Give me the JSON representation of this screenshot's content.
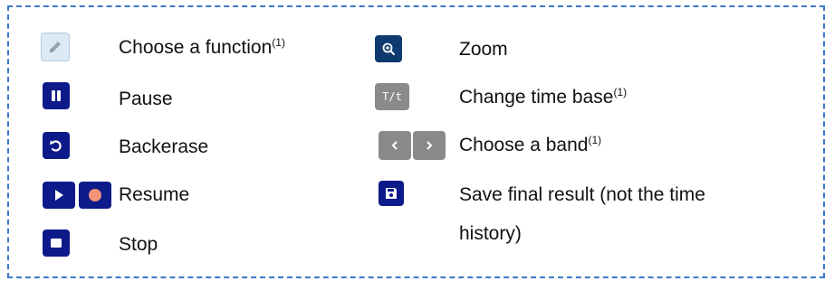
{
  "legend": {
    "left": [
      {
        "icon": "pencil-icon",
        "label": "Choose a function",
        "sup": "(1)"
      },
      {
        "icon": "pause-icon",
        "label": "Pause",
        "sup": ""
      },
      {
        "icon": "undo-icon",
        "label": "Backerase",
        "sup": ""
      },
      {
        "icon": "play-record-icons",
        "label": "Resume",
        "sup": ""
      },
      {
        "icon": "stop-icon",
        "label": "Stop",
        "sup": ""
      }
    ],
    "right": [
      {
        "icon": "zoom-in-icon",
        "label": "Zoom",
        "sup": ""
      },
      {
        "icon": "time-base-icon",
        "label": "Change time base",
        "sup": "(1)",
        "icon_text": "T/t"
      },
      {
        "icon": "chevron-left-right-icons",
        "label": "Choose a band",
        "sup": "(1)"
      },
      {
        "icon": "save-icon",
        "label": "Save final result (not the time",
        "label2": "history)",
        "sup": ""
      }
    ]
  },
  "colors": {
    "border": "#3a78c9",
    "navy": "#0d1a8a",
    "dark_blue": "#0e3a70",
    "gray": "#8a8a8a",
    "record": "#f2937a"
  }
}
